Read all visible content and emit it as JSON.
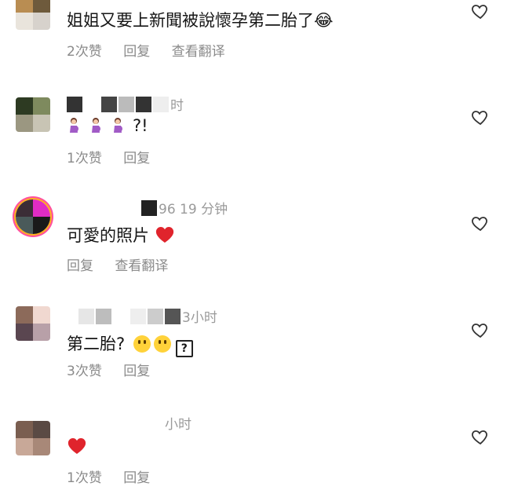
{
  "comments": [
    {
      "meta": "",
      "text": "姐姐又要上新聞被說懷孕第二胎了😂",
      "likes": "2次赞",
      "reply": "回复",
      "translate": "查看翻译"
    },
    {
      "meta": "时",
      "text": "?!",
      "likes": "1次赞",
      "reply": "回复"
    },
    {
      "meta": "96 19 分钟",
      "text": "可愛的照片",
      "reply": "回复",
      "translate": "查看翻译"
    },
    {
      "meta": "3小时",
      "text": "第二胎?",
      "likes": "3次赞",
      "reply": "回复"
    },
    {
      "meta": "小时",
      "text": "",
      "likes": "1次赞",
      "reply": "回复"
    }
  ],
  "icons": {
    "like": "heart-outline-icon",
    "emoji_heart": "red-heart-icon",
    "pregnant": "pregnant-woman-icon",
    "face": "grinning-face-icon",
    "unknown": "unknown-glyph-icon"
  },
  "colors": {
    "accent_heart": "#e0242c",
    "meta": "#9a9a9a",
    "actions": "#8a8a8a"
  }
}
